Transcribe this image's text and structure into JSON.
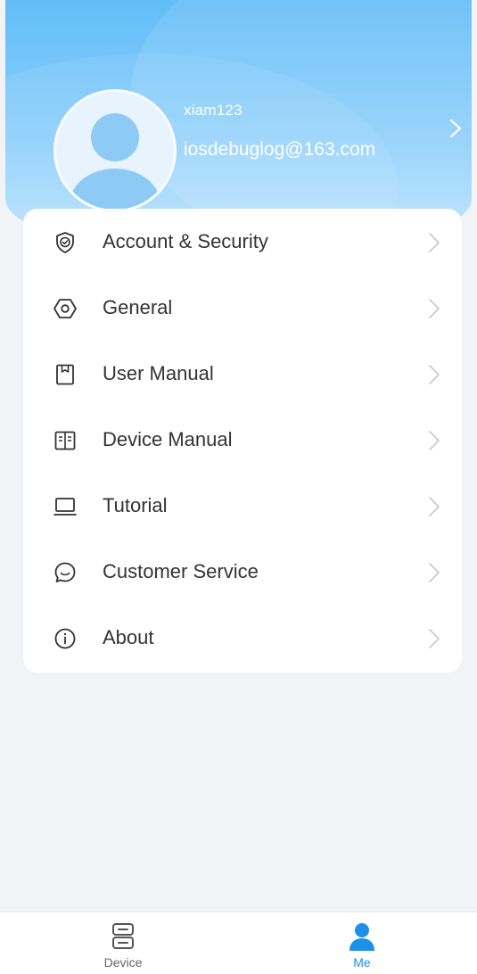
{
  "profile": {
    "username": "xiam123",
    "email": "iosdebuglog@163.com"
  },
  "menu": {
    "items": [
      {
        "label": "Account & Security",
        "icon": "shield-icon"
      },
      {
        "label": "General",
        "icon": "hexagon-settings-icon"
      },
      {
        "label": "User Manual",
        "icon": "bookmark-icon"
      },
      {
        "label": "Device Manual",
        "icon": "open-book-icon"
      },
      {
        "label": "Tutorial",
        "icon": "laptop-icon"
      },
      {
        "label": "Customer Service",
        "icon": "chat-bubble-icon"
      },
      {
        "label": "About",
        "icon": "info-icon"
      }
    ]
  },
  "tabbar": {
    "tabs": [
      {
        "label": "Device",
        "icon": "device-icon",
        "active": false
      },
      {
        "label": "Me",
        "icon": "person-icon",
        "active": true
      }
    ]
  },
  "colors": {
    "accent": "#1e90e8",
    "header_top": "#62bdf8",
    "text_primary": "#333333",
    "chevron": "#c8c8c8"
  }
}
